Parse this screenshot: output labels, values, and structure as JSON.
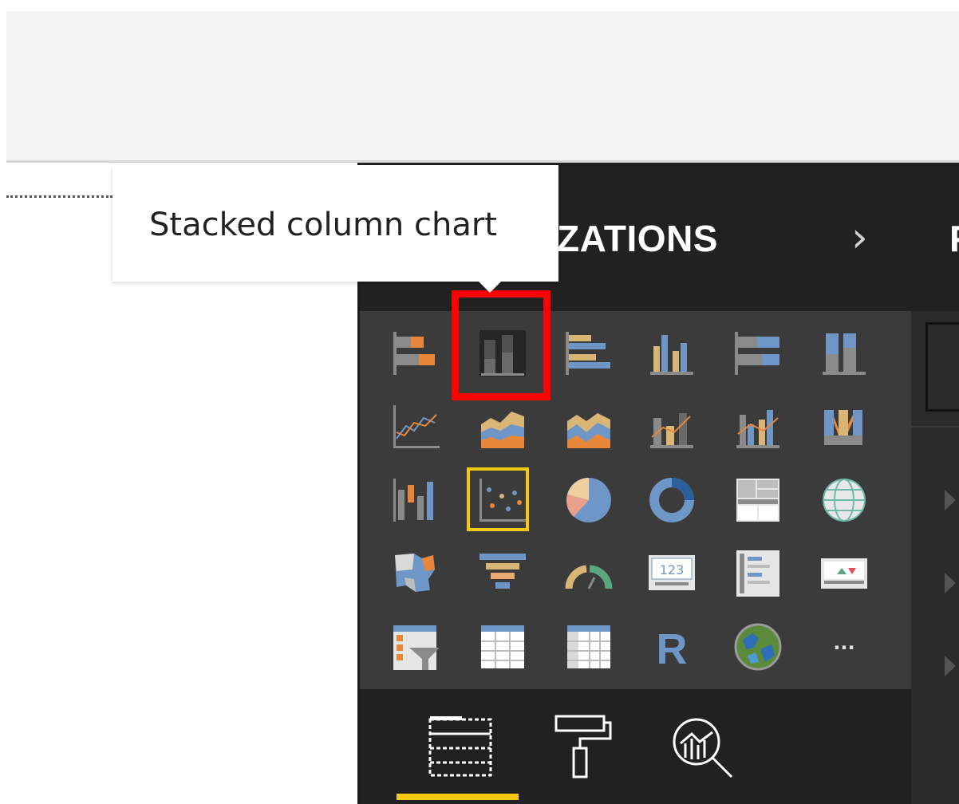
{
  "viz_pane": {
    "title_visible": "ZATIONS",
    "expand_icon": "chevron-right-icon"
  },
  "fields_pane": {
    "title_visible": "F"
  },
  "tooltip": {
    "text": "Stacked column chart"
  },
  "selected_visual": "stacked-column-chart",
  "visuals": [
    {
      "name": "stacked-bar-chart"
    },
    {
      "name": "stacked-column-chart"
    },
    {
      "name": "clustered-bar-chart"
    },
    {
      "name": "clustered-column-chart"
    },
    {
      "name": "100-percent-stacked-bar-chart"
    },
    {
      "name": "100-percent-stacked-column-chart"
    },
    {
      "name": "line-chart"
    },
    {
      "name": "area-chart"
    },
    {
      "name": "stacked-area-chart"
    },
    {
      "name": "line-and-stacked-column-chart"
    },
    {
      "name": "line-and-clustered-column-chart"
    },
    {
      "name": "ribbon-chart"
    },
    {
      "name": "waterfall-chart"
    },
    {
      "name": "scatter-chart"
    },
    {
      "name": "pie-chart"
    },
    {
      "name": "donut-chart"
    },
    {
      "name": "treemap"
    },
    {
      "name": "map"
    },
    {
      "name": "filled-map"
    },
    {
      "name": "funnel"
    },
    {
      "name": "gauge"
    },
    {
      "name": "card"
    },
    {
      "name": "multi-row-card"
    },
    {
      "name": "kpi"
    },
    {
      "name": "slicer"
    },
    {
      "name": "table"
    },
    {
      "name": "matrix"
    },
    {
      "name": "r-script-visual"
    },
    {
      "name": "arcgis-map"
    },
    {
      "name": "more-visuals"
    }
  ],
  "card_text": "123",
  "r_letter": "R",
  "ellipsis": "...",
  "bottom_tabs": [
    {
      "name": "fields-tab",
      "icon": "fields-icon",
      "active": true
    },
    {
      "name": "format-tab",
      "icon": "paint-roller-icon",
      "active": false
    },
    {
      "name": "analytics-tab",
      "icon": "analytics-magnifier-icon",
      "active": false
    }
  ],
  "colors": {
    "accent": "#f2c811",
    "highlight": "#ff0000",
    "pane_bg": "#3b3b3b",
    "header_bg": "#212121",
    "orange": "#e8873a",
    "blue": "#6e97c8",
    "tan": "#d9b676"
  }
}
